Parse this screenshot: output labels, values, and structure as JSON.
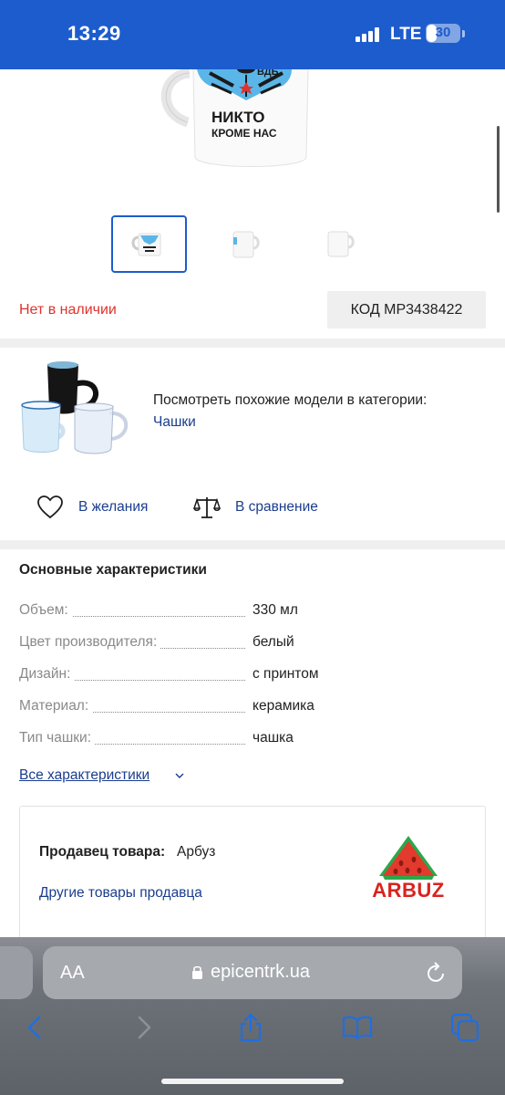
{
  "status_bar": {
    "time": "13:29",
    "network": "LTE",
    "battery": "30",
    "battery_level": 0.3,
    "signal_bars": 4
  },
  "product": {
    "mug_text_line1": "ВДБ",
    "mug_text_line2": "НИКТО",
    "mug_text_line3": "КРОМЕ НАС",
    "stock_status": "Нет в наличии",
    "code": "КОД MP3438422",
    "selected_thumbnail": 1
  },
  "similar": {
    "text": "Посмотреть похожие модели в категории:",
    "link": "Чашки"
  },
  "actions": {
    "wishlist": "В желания",
    "compare": "В сравнение"
  },
  "specs": {
    "title": "Основные характеристики",
    "rows": [
      {
        "label": "Объем:",
        "value": "330 мл"
      },
      {
        "label": "Цвет производителя:",
        "value": "белый"
      },
      {
        "label": "Дизайн:",
        "value": "с принтом"
      },
      {
        "label": "Материал:",
        "value": "керамика"
      },
      {
        "label": "Тип чашки:",
        "value": "чашка"
      }
    ],
    "all_link": "Все характеристики"
  },
  "seller": {
    "title": "Продавец товара:",
    "name": "Арбуз",
    "other_link": "Другие товары продавца",
    "logo_text": "ARBUZ"
  },
  "browser": {
    "aa": "AA",
    "url": "epicentrk.ua"
  },
  "colors": {
    "brand_blue": "#1d5ccd",
    "link_blue": "#1a3d8f",
    "out_of_stock_red": "#e0322b",
    "logo_red": "#d9231d",
    "logo_green": "#2aa84a"
  }
}
